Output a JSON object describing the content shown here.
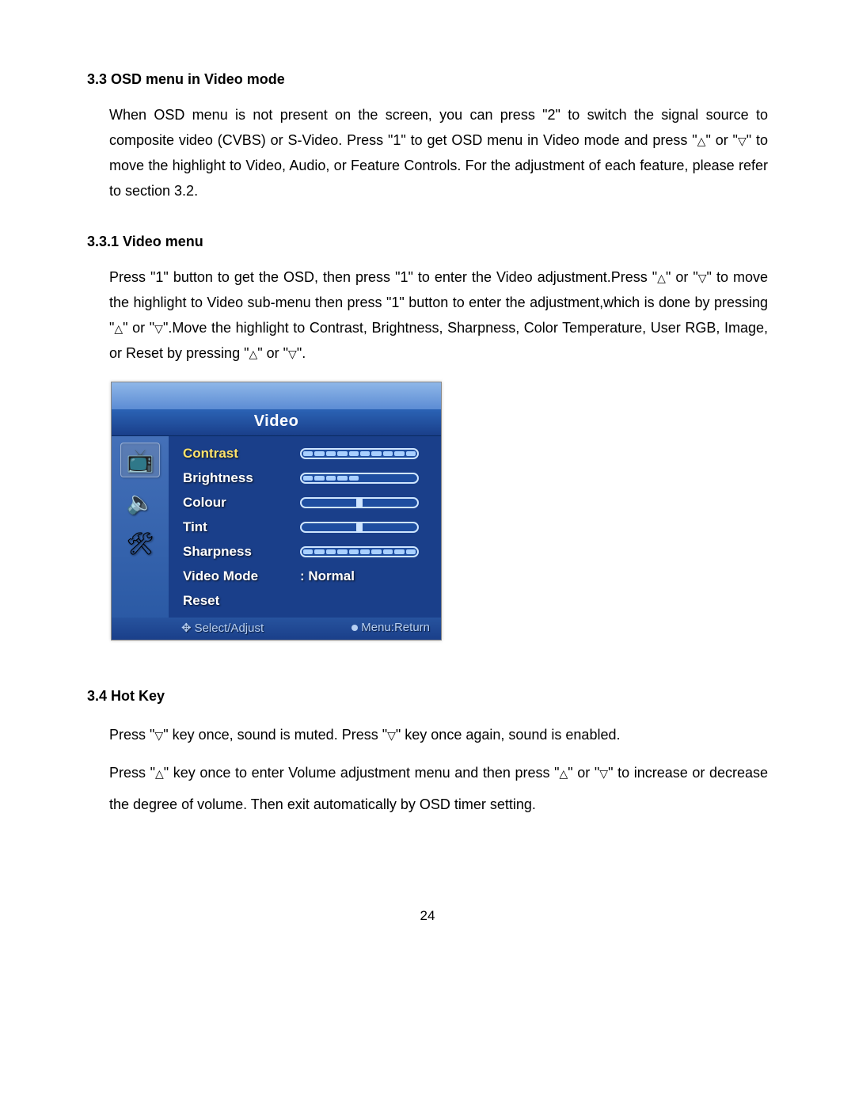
{
  "sections": {
    "s33": {
      "heading": "3.3 OSD menu in Video mode",
      "p1a": "When OSD menu is not present on the screen, you can press \"2\" to switch the signal source to composite video (CVBS) or S-Video. Press \"1\" to get OSD menu in Video mode and press   \"",
      "p1b": "\" or \"",
      "p1c": "\" to move the highlight to Video, Audio, or Feature Controls. For the adjustment of each feature, please refer to section 3.2."
    },
    "s331": {
      "heading": "3.3.1 Video menu",
      "p1a": "Press \"1\" button to get the OSD, then press \"1\" to enter the Video adjustment.Press \"",
      "p1b": "\" or \"",
      "p1c": "\" to move the highlight to Video sub-menu then press \"1\" button to enter the adjustment,which is done by pressing \"",
      "p1d": "\" or \"",
      "p1e": "\".Move the highlight to Contrast, Brightness, Sharpness, Color Temperature, User RGB, Image, or Reset by pressing \"",
      "p1f": "\" or \"",
      "p1g": "\"."
    },
    "s34": {
      "heading": "3.4 Hot Key",
      "p1a": "Press \"",
      "p1b": "\" key once, sound is muted. Press \"",
      "p1c": "\" key once again, sound is enabled.",
      "p2a": "Press \"",
      "p2b": "\" key once to enter Volume adjustment menu and then press \"",
      "p2c": "\" or \"",
      "p2d": "\" to increase or decrease the degree of volume. Then exit automatically by OSD timer setting."
    }
  },
  "symbols": {
    "up": "△",
    "down": "▽"
  },
  "osd": {
    "title": "Video",
    "sidebar": [
      {
        "name": "video-icon",
        "glyph": "📺",
        "selected": true
      },
      {
        "name": "audio-icon",
        "glyph": "🔈",
        "selected": false
      },
      {
        "name": "feature-icon",
        "glyph": "🛠",
        "selected": false
      }
    ],
    "rows": [
      {
        "label": "Contrast",
        "type": "slider-fill",
        "fill": 10,
        "total": 10,
        "selected": true
      },
      {
        "label": "Brightness",
        "type": "slider-fill",
        "fill": 5,
        "total": 10,
        "selected": false
      },
      {
        "label": "Colour",
        "type": "slider-thumb",
        "pos": 50,
        "selected": false
      },
      {
        "label": "Tint",
        "type": "slider-thumb",
        "pos": 50,
        "selected": false
      },
      {
        "label": "Sharpness",
        "type": "slider-fill",
        "fill": 10,
        "total": 10,
        "selected": false
      },
      {
        "label": "Video Mode",
        "type": "value",
        "value": ":  Normal",
        "selected": false
      },
      {
        "label": "Reset",
        "type": "none",
        "selected": false
      }
    ],
    "footer": {
      "left": "Select/Adjust",
      "right": "Menu:Return"
    }
  },
  "page_number": "24"
}
